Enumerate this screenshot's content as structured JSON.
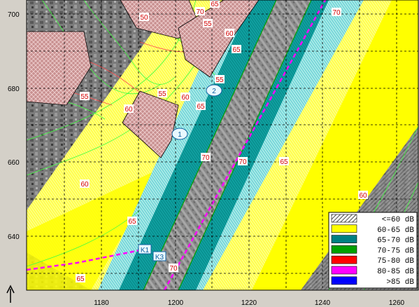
{
  "map": {
    "y_ticks": [
      "700",
      "680",
      "660",
      "640"
    ],
    "x_ticks": [
      "1180",
      "1200",
      "1220",
      "1240",
      "1260"
    ],
    "north_arrow": "north-arrow-icon",
    "contour_labels": [
      "50",
      "55",
      "60",
      "65",
      "70",
      "55",
      "60",
      "65",
      "70",
      "55",
      "55",
      "60",
      "65",
      "60",
      "70",
      "70",
      "65",
      "60",
      "65",
      "65",
      "70"
    ],
    "receiver_points": [
      "1",
      "2"
    ],
    "source_points": [
      "K1",
      "K3"
    ],
    "colors": {
      "road_center": "#ff00ff",
      "grid": "#000000",
      "building": "#c88c8c",
      "band_60_65": "#ffff00",
      "band_65_70": "#008080",
      "band_70_75": "#00a000"
    }
  },
  "legend": {
    "items": [
      {
        "label": "<=60 dB",
        "color": "#ffffff",
        "pattern": "hatch-black"
      },
      {
        "label": "60-65 dB",
        "color": "#ffff00"
      },
      {
        "label": "65-70 dB",
        "color": "#008080"
      },
      {
        "label": "70-75 dB",
        "color": "#00a000"
      },
      {
        "label": "75-80 dB",
        "color": "#ff0000"
      },
      {
        "label": "80-85 dB",
        "color": "#ff00ff"
      },
      {
        "label": ">85 dB",
        "color": "#0000ff"
      }
    ]
  }
}
